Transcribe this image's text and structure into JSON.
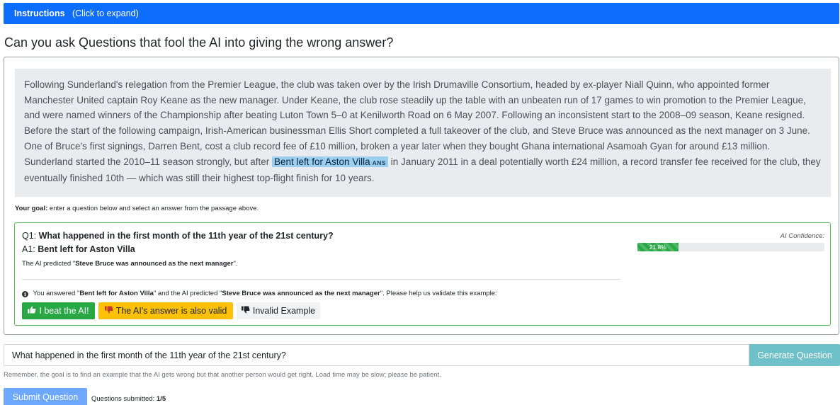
{
  "instructions": {
    "title": "Instructions",
    "hint": "(Click to expand)"
  },
  "page_title": "Can you ask Questions that fool the AI into giving the wrong answer?",
  "passage": {
    "before": "Following Sunderland's relegation from the Premier League, the club was taken over by the Irish Drumaville Consortium, headed by ex-player Niall Quinn, who appointed former Manchester United captain Roy Keane as the new manager. Under Keane, the club rose steadily up the table with an unbeaten run of 17 games to win promotion to the Premier League, and were named winners of the Championship after beating Luton Town 5–0 at Kenilworth Road on 6 May 2007. Following an inconsistent start to the 2008–09 season, Keane resigned. Before the start of the following campaign, Irish-American businessman Ellis Short completed a full takeover of the club, and Steve Bruce was announced as the next manager on 3 June. One of Bruce's first signings, Darren Bent, cost a club record fee of £10 million, broken a year later when they bought Ghana international Asamoah Gyan for around £13 million. Sunderland started the 2010–11 season strongly, but after ",
    "highlight": "Bent left for Aston Villa",
    "highlight_tag": "ANS",
    "after": " in January 2011 in a deal potentially worth £24 million, a record transfer fee received for the club, they eventually finished 10th — which was still their highest top-flight finish for 10 years."
  },
  "goal": {
    "label": "Your goal:",
    "text": " enter a question below and select an answer from the passage above."
  },
  "qa": {
    "q_prefix": "Q1: ",
    "question": "What happened in the first month of the 11th year of the 21st century?",
    "a_prefix": "A1: ",
    "answer": "Bent left for Aston Villa",
    "pred_prefix": "The AI predicted \"",
    "prediction": "Steve Bruce was announced as the next manager",
    "pred_suffix": "\".",
    "confidence_label": "AI Confidence:",
    "confidence_text": "21.8%",
    "confidence_value": 21.8
  },
  "validate": {
    "p1": " You answered \"",
    "answer": "Bent left for Aston Villa",
    "p2": "\" and the AI predicted \"",
    "prediction": "Steve Bruce was announced as the next manager",
    "p3": "\". Please help us validate this example:"
  },
  "buttons": {
    "beat": "I beat the AI!",
    "valid": "The AI's answer is also valid",
    "invalid": "Invalid Example",
    "generate": "Generate Question",
    "submit": "Submit Question"
  },
  "input": {
    "value": "What happened in the first month of the 11th year of the 21st century?"
  },
  "remember": "Remember, the goal is to find an example that the AI gets wrong but that another person would get right. Load time may be slow; please be patient.",
  "submitted": {
    "label": "Questions submitted: ",
    "count": "1/5"
  },
  "icons": {
    "info": "info-icon",
    "thumbs_up": "thumbs-up-icon",
    "thumbs_down": "thumbs-down-icon"
  },
  "colors": {
    "primary": "#0d6efd",
    "success": "#28a745",
    "warning": "#ffc107",
    "info": "#6fc1c9"
  }
}
